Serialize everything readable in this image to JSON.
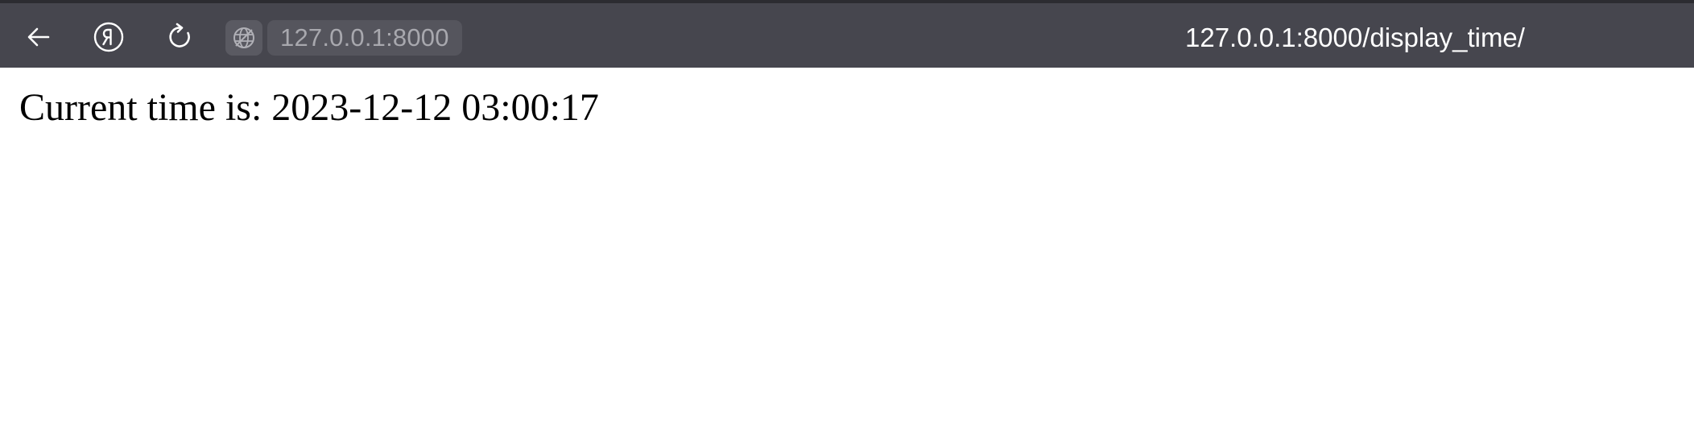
{
  "browser": {
    "address_chip": "127.0.0.1:8000",
    "page_url": "127.0.0.1:8000/display_time/",
    "icons": {
      "back": "back-arrow-icon",
      "yandex": "yandex-logo-icon",
      "reload": "reload-icon",
      "site_info": "globe-icon"
    }
  },
  "page": {
    "text": "Current time is: 2023-12-12 03:00:17"
  },
  "colors": {
    "toolbar": "#46464e",
    "chip": "#55555d",
    "chip_text": "#a8a8ae",
    "url_text": "#ffffff",
    "page_bg": "#ffffff"
  }
}
